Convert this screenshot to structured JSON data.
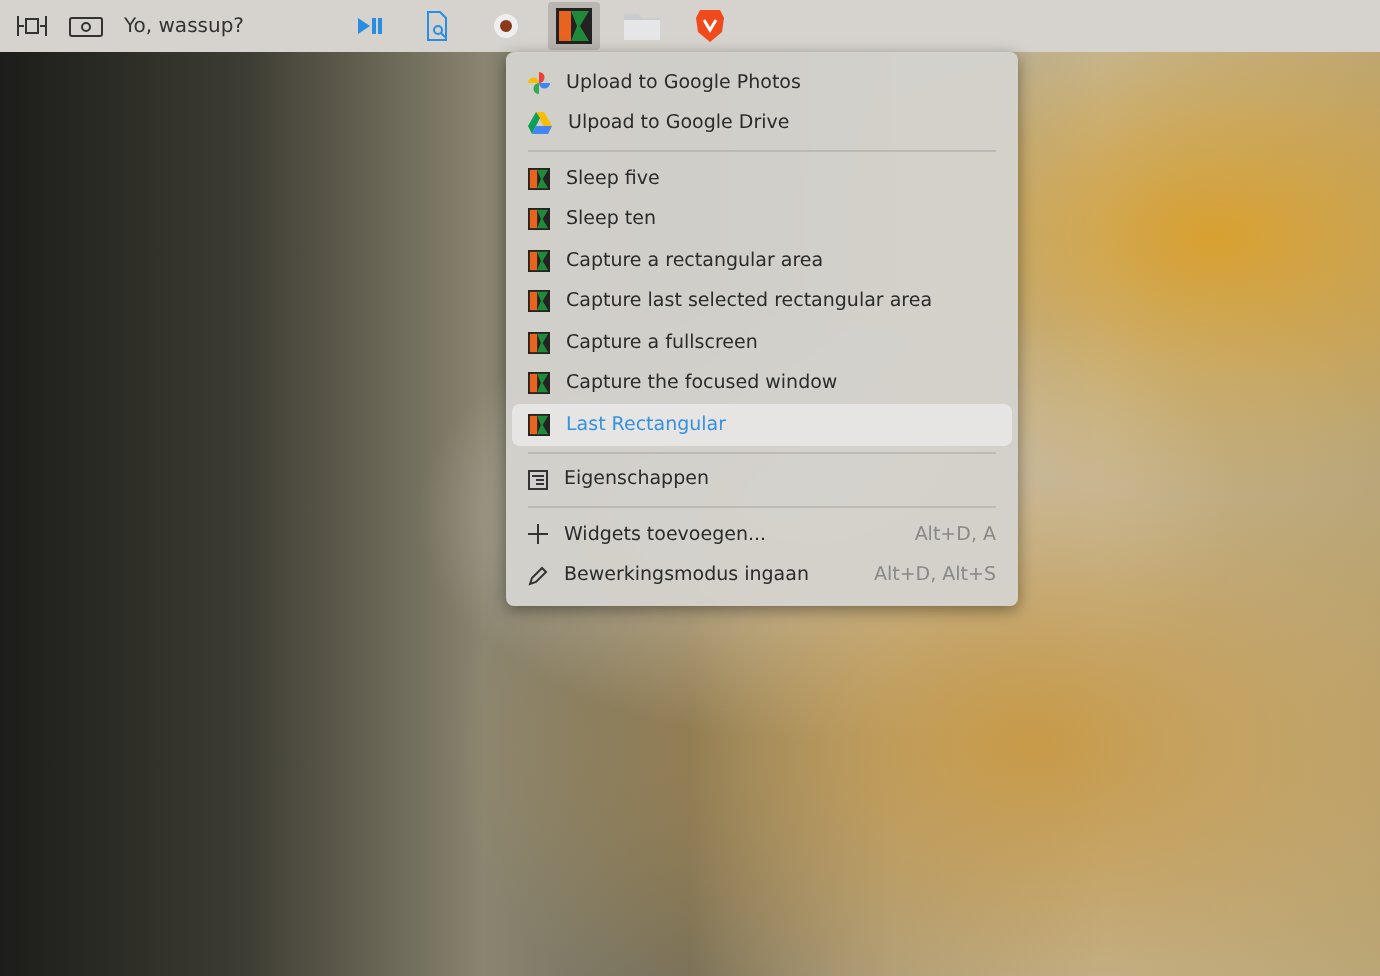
{
  "panel": {
    "widget_text": "Yo, wassup?"
  },
  "context_menu": {
    "sections": [
      {
        "items": [
          {
            "kind": "photos",
            "label": "Upload to Google Photos",
            "selected": false
          },
          {
            "kind": "drive",
            "label": "Ulpoad to Google Drive",
            "selected": false
          }
        ]
      },
      {
        "items": [
          {
            "kind": "app",
            "label": "Sleep five",
            "selected": false
          },
          {
            "kind": "app",
            "label": "Sleep ten",
            "selected": false
          },
          {
            "kind": "app",
            "label": "Capture a rectangular area",
            "selected": false
          },
          {
            "kind": "app",
            "label": "Capture last selected rectangular area",
            "selected": false
          },
          {
            "kind": "app",
            "label": "Capture a fullscreen",
            "selected": false
          },
          {
            "kind": "app",
            "label": "Capture the focused window",
            "selected": false
          },
          {
            "kind": "app",
            "label": "Last Rectangular",
            "selected": true
          }
        ]
      },
      {
        "items": [
          {
            "kind": "settings",
            "label": "Eigenschappen",
            "selected": false
          }
        ]
      },
      {
        "items": [
          {
            "kind": "add",
            "label": "Widgets toevoegen...",
            "shortcut": "Alt+D, A",
            "selected": false
          },
          {
            "kind": "edit",
            "label": "Bewerkingsmodus ingaan",
            "shortcut": "Alt+D, Alt+S",
            "selected": false
          }
        ]
      }
    ]
  }
}
